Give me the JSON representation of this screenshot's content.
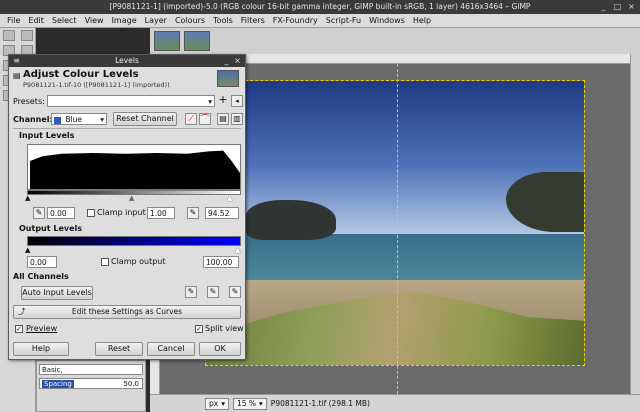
{
  "window": {
    "title": "[P9081121-1] (imported)-5.0 (RGB colour 16-bit gamma integer, GIMP built-in sRGB, 1 layer) 4616x3464 – GIMP"
  },
  "menubar": [
    "File",
    "Edit",
    "Select",
    "View",
    "Image",
    "Layer",
    "Colours",
    "Tools",
    "Filters",
    "FX-Foundry",
    "Script-Fu",
    "Windows",
    "Help"
  ],
  "dialog": {
    "window_title": "Levels",
    "title": "Adjust Colour Levels",
    "subtitle": "P9081121-1.tif-10 ([P9081121-1] (imported))",
    "presets_label": "Presets:",
    "presets_value": "",
    "channel_label": "Channel:",
    "channel_value": "Blue",
    "reset_channel": "Reset Channel",
    "input_levels_label": "Input Levels",
    "input_low": "0.00",
    "clamp_input": "Clamp input",
    "gamma": "1.00",
    "input_high": "94.52",
    "output_levels_label": "Output Levels",
    "output_low": "0.00",
    "clamp_output": "Clamp output",
    "output_high": "100.00",
    "all_channels_label": "All Channels",
    "auto_input_levels": "Auto Input Levels",
    "edit_as_curves": "Edit these Settings as Curves",
    "preview_label": "Preview",
    "split_view_label": "Split view",
    "help": "Help",
    "reset": "Reset",
    "cancel": "Cancel",
    "ok": "OK"
  },
  "dock": {
    "mode_value": "Basic,",
    "spacing_label": "Spacing",
    "spacing_value": "50.0"
  },
  "status": {
    "unit": "px",
    "zoom": "15 %",
    "file_info": "P9081121-1.tif (298.1 MB)"
  }
}
